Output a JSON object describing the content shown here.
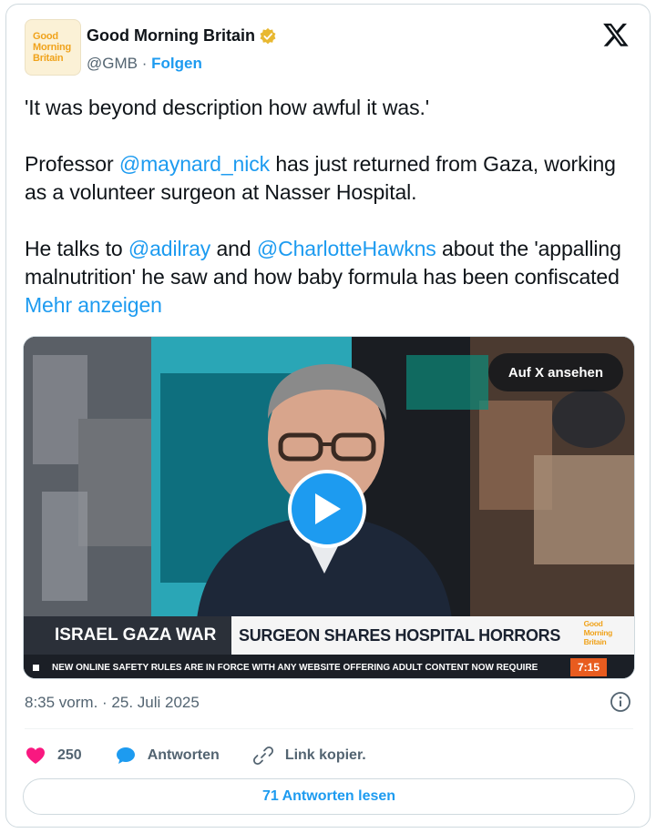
{
  "author": {
    "name": "Good Morning Britain",
    "handle": "@GMB",
    "separator": "·",
    "follow_label": "Folgen",
    "avatar_text": [
      "Good",
      "Morning",
      "Britain"
    ]
  },
  "tweet": {
    "p1": "'It was beyond description how awful it was.'",
    "p2_a": "Professor ",
    "p2_mention": "@maynard_nick",
    "p2_b": " has just returned from Gaza, working as a volunteer surgeon at Nasser Hospital.",
    "p3_a": "He talks to ",
    "p3_mention1": "@adilray",
    "p3_b": " and ",
    "p3_mention2": "@CharlotteHawkns",
    "p3_c": " about the 'appalling malnutrition' he saw and how baby formula has been confiscated ",
    "more_label": "Mehr anzeigen"
  },
  "media": {
    "watch_label": "Auf X ansehen",
    "lower_third_left": "ISRAEL GAZA WAR",
    "lower_third_right": "SURGEON SHARES HOSPITAL HORRORS",
    "lower_third_logo": [
      "Good",
      "Morning",
      "Britain"
    ],
    "ticker": "NEW ONLINE SAFETY RULES ARE IN FORCE WITH ANY WEBSITE OFFERING ADULT CONTENT NOW REQUIRE",
    "clock": "7:15"
  },
  "footer": {
    "timestamp": "8:35 vorm. · 25. Juli 2025",
    "likes": "250",
    "reply_label": "Antworten",
    "copy_link_label": "Link kopier.",
    "read_replies_label": "71 Antworten lesen"
  },
  "colors": {
    "accent": "#1d9bf0",
    "like": "#f91880",
    "brand": "#f0a31c"
  },
  "icons": [
    "verified-badge-icon",
    "x-logo-icon",
    "play-icon",
    "info-icon",
    "heart-icon",
    "reply-bubble-icon",
    "link-icon"
  ]
}
